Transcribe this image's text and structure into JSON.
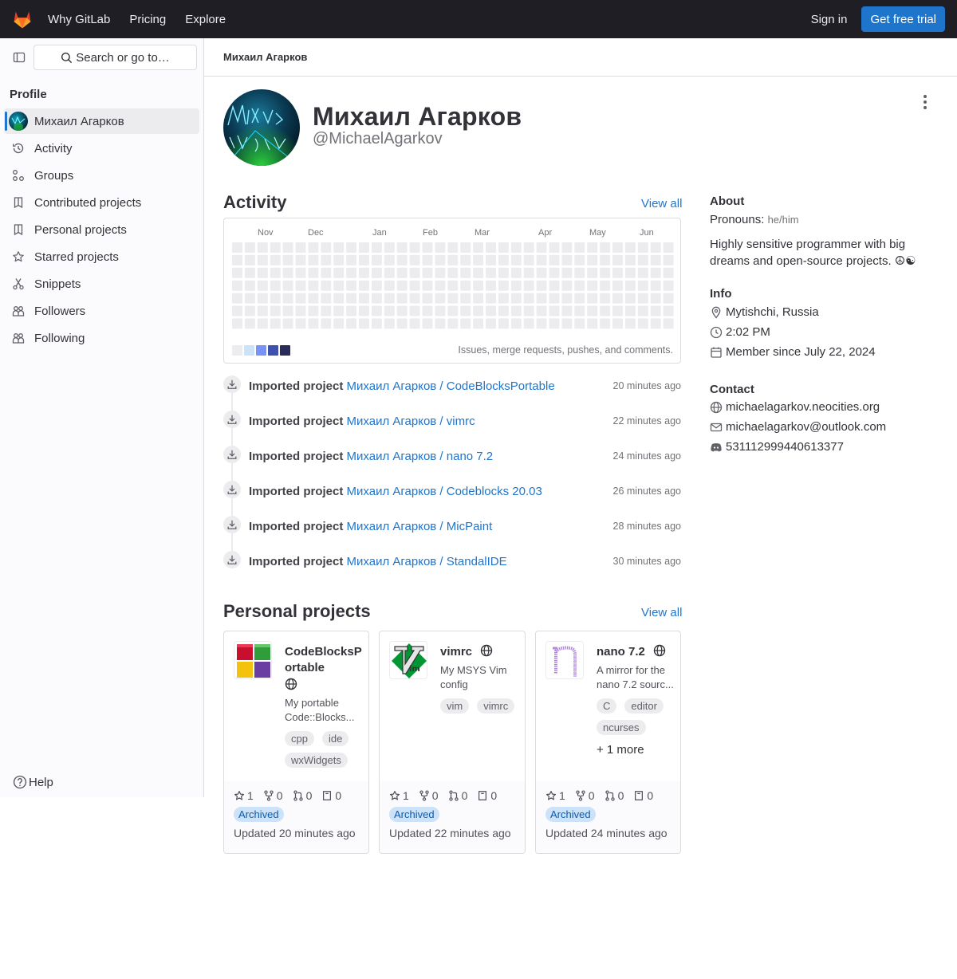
{
  "topbar": {
    "nav": [
      "Why GitLab",
      "Pricing",
      "Explore"
    ],
    "signin": "Sign in",
    "trial": "Get free trial"
  },
  "sidebar": {
    "search_placeholder": "Search or go to…",
    "section_title": "Profile",
    "items": [
      {
        "label": "Михаил Агарков",
        "icon": "user-avatar"
      },
      {
        "label": "Activity",
        "icon": "history-icon"
      },
      {
        "label": "Groups",
        "icon": "group-icon"
      },
      {
        "label": "Contributed projects",
        "icon": "project-icon"
      },
      {
        "label": "Personal projects",
        "icon": "project-icon"
      },
      {
        "label": "Starred projects",
        "icon": "star-icon"
      },
      {
        "label": "Snippets",
        "icon": "snippet-icon"
      },
      {
        "label": "Followers",
        "icon": "users-icon"
      },
      {
        "label": "Following",
        "icon": "users-icon"
      }
    ],
    "help": "Help"
  },
  "breadcrumb": "Михаил Агарков",
  "profile": {
    "name": "Михаил Агарков",
    "handle": "@MichaelAgarkov"
  },
  "activity": {
    "title": "Activity",
    "view_all": "View all",
    "months": [
      "Nov",
      "Dec",
      "Jan",
      "Feb",
      "Mar",
      "Apr",
      "May",
      "Jun"
    ],
    "legend_colors": [
      "#ececef",
      "#cbe2f9",
      "#7992f5",
      "#3f51ae",
      "#2a2b59"
    ],
    "calendar_note": "Issues, merge requests, pushes, and comments.",
    "events": [
      {
        "action": "Imported project",
        "project": "Михаил Агарков / CodeBlocksPortable",
        "time": "20 minutes ago"
      },
      {
        "action": "Imported project",
        "project": "Михаил Агарков / vimrc",
        "time": "22 minutes ago"
      },
      {
        "action": "Imported project",
        "project": "Михаил Агарков / nano 7.2",
        "time": "24 minutes ago"
      },
      {
        "action": "Imported project",
        "project": "Михаил Агарков / Codeblocks 20.03",
        "time": "26 minutes ago"
      },
      {
        "action": "Imported project",
        "project": "Михаил Агарков / MicPaint",
        "time": "28 minutes ago"
      },
      {
        "action": "Imported project",
        "project": "Михаил Агарков / StandalIDE",
        "time": "30 minutes ago"
      }
    ]
  },
  "about": {
    "title": "About",
    "pronouns_label": "Pronouns:",
    "pronouns": "he/him",
    "bio": "Highly sensitive programmer with big dreams and open-source projects. ☮☯",
    "info_title": "Info",
    "location": "Mytishchi, Russia",
    "time": "2:02 PM",
    "member_since": "Member since July 22, 2024",
    "contact_title": "Contact",
    "website": "michaelagarkov.neocities.org",
    "email": "michaelagarkov@outlook.com",
    "discord": "531112999440613377"
  },
  "projects": {
    "title": "Personal projects",
    "view_all": "View all",
    "items": [
      {
        "name": "CodeBlocksPortable",
        "description": "My portable Code::Blocks...",
        "tags": [
          "cpp",
          "ide",
          "wxWidgets"
        ],
        "more": "",
        "stars": "1",
        "forks": "0",
        "mrs": "0",
        "issues": "0",
        "badge": "Archived",
        "updated": "Updated 20 minutes ago"
      },
      {
        "name": "vimrc",
        "description": "My MSYS Vim config",
        "tags": [
          "vim",
          "vimrc"
        ],
        "more": "",
        "stars": "1",
        "forks": "0",
        "mrs": "0",
        "issues": "0",
        "badge": "Archived",
        "updated": "Updated 22 minutes ago"
      },
      {
        "name": "nano 7.2",
        "description": "A mirror for the nano 7.2 sourc...",
        "tags": [
          "C",
          "editor",
          "ncurses"
        ],
        "more": "+ 1 more",
        "stars": "1",
        "forks": "0",
        "mrs": "0",
        "issues": "0",
        "badge": "Archived",
        "updated": "Updated 24 minutes ago"
      }
    ]
  },
  "colors": {
    "accent": "#1f75cb",
    "topbar": "#1f1e24",
    "badge_bg": "#cbe2f9"
  }
}
